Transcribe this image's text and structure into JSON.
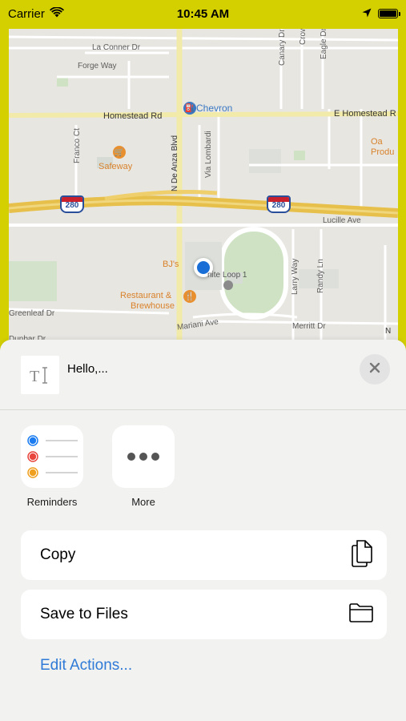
{
  "status_bar": {
    "carrier": "Carrier",
    "time": "10:45 AM",
    "wifi_icon": "wifi-icon",
    "location_icon": "location-arrow-icon",
    "battery_level": 1.0
  },
  "map": {
    "labels": {
      "la_conner": "La Conner Dr",
      "forge_way": "Forge Way",
      "homestead": "Homestead Rd",
      "e_homestead": "E Homestead R",
      "chevron": "Chevron",
      "safeway": "Safeway",
      "franco_ct": "Franco Ct",
      "de_anza": "N De Anza Blvd",
      "via_lombardi": "Via Lombardi",
      "canary": "Canary Dr",
      "crow": "Crow",
      "eagle": "Eagle Dr",
      "oak_prod": "Oa Produ",
      "lucille": "Lucille Ave",
      "infinite_loop": "nite Loop 1",
      "bjs_1": "BJ's",
      "bjs_2": "Restaurant &",
      "bjs_3": "Brewhouse",
      "larry": "Larry Way",
      "randy": "Randy Ln",
      "greenleaf": "Greenleaf Dr",
      "mariani": "Mariani Ave",
      "merritt": "Merritt Dr",
      "dunbar": "Dunbar Dr",
      "n_right": "N"
    },
    "shield_280": "280",
    "colors": {
      "land": "#e8e6e1",
      "freeway": "#e6c04a",
      "major_road": "#f5f0c8",
      "park": "#cfe3c4",
      "building": "#d6dbd6"
    }
  },
  "sheet": {
    "title": "Hello,...",
    "doc_icon": "text-document-icon",
    "close_icon": "close-icon",
    "apps": [
      {
        "label": "Reminders",
        "icon": "reminders-icon"
      },
      {
        "label": "More",
        "icon": "more-icon"
      }
    ],
    "actions": [
      {
        "label": "Copy",
        "icon": "copy-icon"
      },
      {
        "label": "Save to Files",
        "icon": "folder-icon"
      }
    ],
    "edit_actions": "Edit Actions...",
    "accent": "#2f7ad6"
  }
}
